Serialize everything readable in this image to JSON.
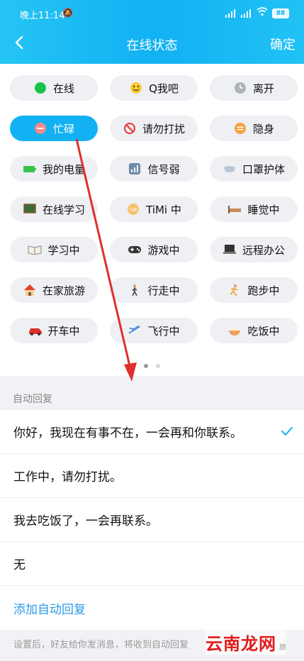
{
  "status": {
    "time": "晚上11:14",
    "battery": "88"
  },
  "nav": {
    "title": "在线状态",
    "confirm": "确定"
  },
  "statuses": [
    {
      "label": "在线",
      "icon": "green-dot-icon",
      "active": false
    },
    {
      "label": "Q我吧",
      "icon": "smile-icon",
      "active": false
    },
    {
      "label": "离开",
      "icon": "clock-icon",
      "active": false
    },
    {
      "label": "忙碌",
      "icon": "busy-icon",
      "active": true
    },
    {
      "label": "请勿打扰",
      "icon": "no-entry-icon",
      "active": false
    },
    {
      "label": "隐身",
      "icon": "invisible-icon",
      "active": false
    },
    {
      "label": "我的电量",
      "icon": "battery-icon",
      "active": false
    },
    {
      "label": "信号弱",
      "icon": "signal-icon",
      "active": false
    },
    {
      "label": "口罩护体",
      "icon": "mask-icon",
      "active": false
    },
    {
      "label": "在线学习",
      "icon": "blackboard-icon",
      "active": false
    },
    {
      "label": "TiMi 中",
      "icon": "timi-icon",
      "active": false
    },
    {
      "label": "睡觉中",
      "icon": "bed-icon",
      "active": false
    },
    {
      "label": "学习中",
      "icon": "book-icon",
      "active": false
    },
    {
      "label": "游戏中",
      "icon": "gamepad-icon",
      "active": false
    },
    {
      "label": "远程办公",
      "icon": "laptop-icon",
      "active": false
    },
    {
      "label": "在家旅游",
      "icon": "house-icon",
      "active": false
    },
    {
      "label": "行走中",
      "icon": "walking-icon",
      "active": false
    },
    {
      "label": "跑步中",
      "icon": "running-icon",
      "active": false
    },
    {
      "label": "开车中",
      "icon": "car-icon",
      "active": false
    },
    {
      "label": "飞行中",
      "icon": "airplane-icon",
      "active": false
    },
    {
      "label": "吃饭中",
      "icon": "bowl-icon",
      "active": false
    }
  ],
  "auto_reply": {
    "section_title": "自动回复",
    "options": [
      {
        "text": "你好，我现在有事不在，一会再和你联系。",
        "selected": true
      },
      {
        "text": "工作中，请勿打扰。",
        "selected": false
      },
      {
        "text": "我去吃饭了，一会再联系。",
        "selected": false
      },
      {
        "text": "无",
        "selected": false
      }
    ],
    "add_label": "添加自动回复"
  },
  "footer_note": "设置后，好友给你发消息，将收到自动回复",
  "watermark": {
    "text": "云南龙网",
    "suffix": "旅"
  },
  "colors": {
    "accent": "#12b1f3",
    "arrow": "#e0302b"
  }
}
